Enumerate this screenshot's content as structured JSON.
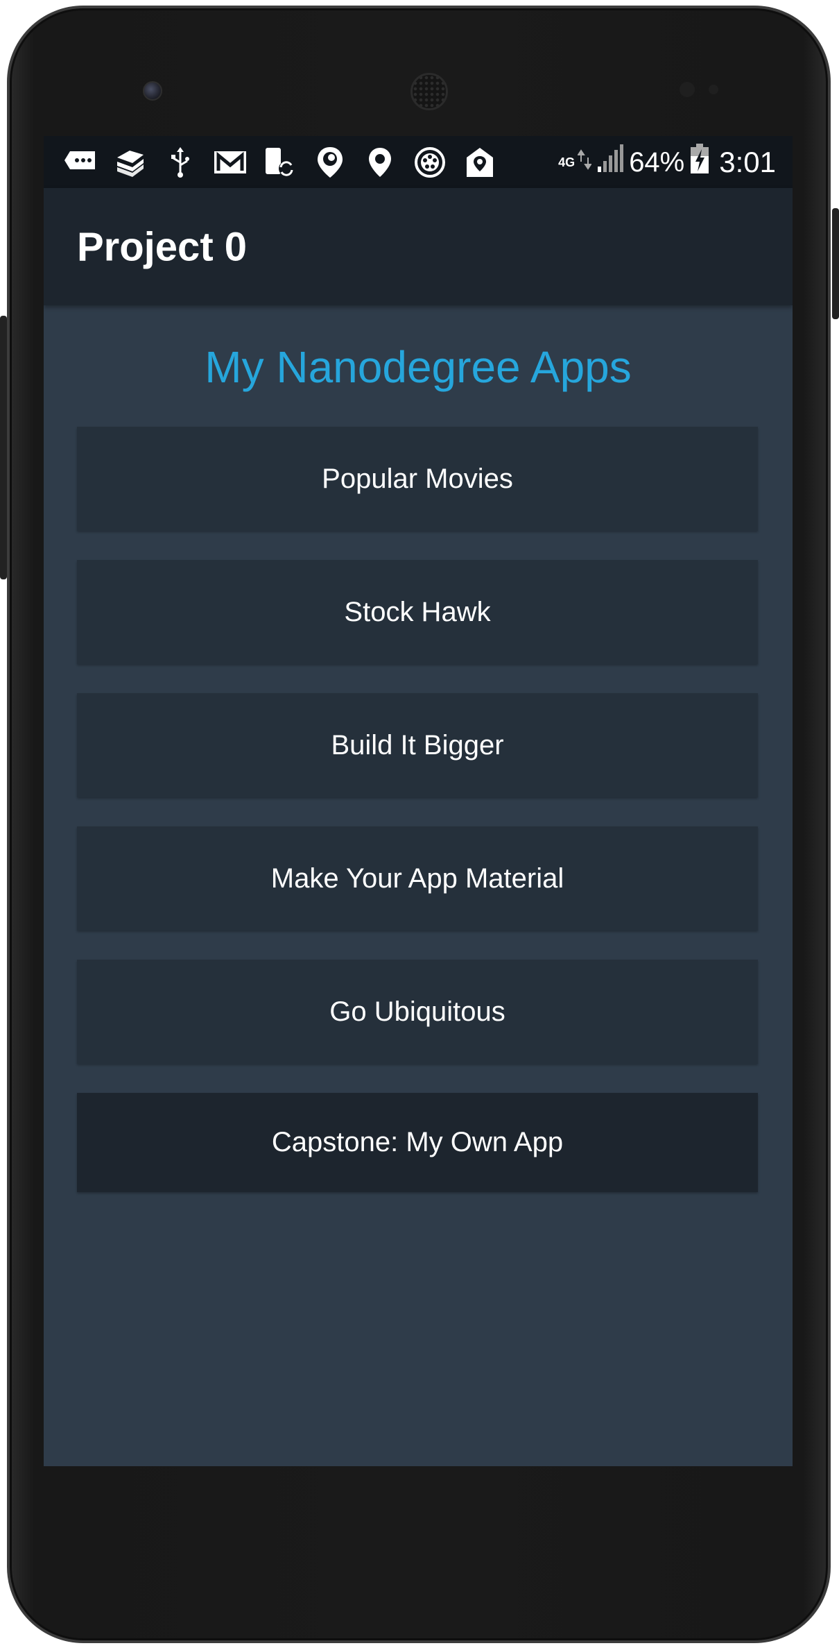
{
  "status_bar": {
    "icons": [
      "message-icon",
      "notes-icon",
      "usb-icon",
      "gmail-icon",
      "phone-sync-icon",
      "periscope-icon",
      "location-pin-icon",
      "film-reel-icon",
      "home-location-icon"
    ],
    "network_label": "4G",
    "battery_percent": "64%",
    "time": "3:01"
  },
  "app_bar": {
    "title": "Project 0"
  },
  "main": {
    "heading": "My Nanodegree Apps",
    "buttons": [
      {
        "label": "Popular Movies"
      },
      {
        "label": "Stock Hawk"
      },
      {
        "label": "Build It Bigger"
      },
      {
        "label": "Make Your App Material"
      },
      {
        "label": "Go Ubiquitous"
      },
      {
        "label": "Capstone: My Own App"
      }
    ]
  },
  "colors": {
    "background": "#2f3c4a",
    "app_bar": "#1d252e",
    "status_bar": "#11161c",
    "button": "#25303b",
    "capstone_button": "#1d252e",
    "accent": "#26a6dc"
  }
}
